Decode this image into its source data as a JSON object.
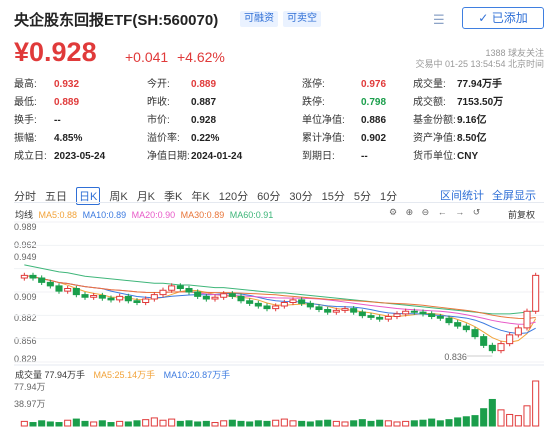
{
  "header": {
    "title": "央企股东回报ETF(SH:560070)",
    "tag_margin": "可融资",
    "tag_short": "可卖空",
    "added_label": "已添加",
    "price": "¥0.928",
    "change": "+0.041",
    "change_pct": "+4.62%",
    "followers": "1388 球友关注",
    "trade_time": "交易中 01-25 13:54:54 北京时间"
  },
  "stats": [
    [
      {
        "label": "最高:",
        "value": "0.932",
        "color": "up"
      },
      {
        "label": "今开:",
        "value": "0.889",
        "color": "up"
      },
      {
        "label": "涨停:",
        "value": "0.976",
        "color": "up"
      },
      {
        "label": "成交量:",
        "value": "77.94万手",
        "color": ""
      }
    ],
    [
      {
        "label": "最低:",
        "value": "0.889",
        "color": "up"
      },
      {
        "label": "昨收:",
        "value": "0.887",
        "color": ""
      },
      {
        "label": "跌停:",
        "value": "0.798",
        "color": "down"
      },
      {
        "label": "成交额:",
        "value": "7153.50万",
        "color": ""
      }
    ],
    [
      {
        "label": "换手:",
        "value": "--",
        "color": ""
      },
      {
        "label": "市价:",
        "value": "0.928",
        "color": ""
      },
      {
        "label": "单位净值:",
        "value": "0.886",
        "color": ""
      },
      {
        "label": "基金份额:",
        "value": "9.16亿",
        "color": ""
      }
    ],
    [
      {
        "label": "振幅:",
        "value": "4.85%",
        "color": ""
      },
      {
        "label": "溢价率:",
        "value": "0.22%",
        "color": ""
      },
      {
        "label": "累计净值:",
        "value": "0.902",
        "color": ""
      },
      {
        "label": "资产净值:",
        "value": "8.50亿",
        "color": ""
      }
    ],
    [
      {
        "label": "成立日:",
        "value": "2023-05-24",
        "color": ""
      },
      {
        "label": "净值日期:",
        "value": "2024-01-24",
        "color": ""
      },
      {
        "label": "到期日:",
        "value": "--",
        "color": ""
      },
      {
        "label": "货币单位:",
        "value": "CNY",
        "color": ""
      }
    ]
  ],
  "periods": [
    "分时",
    "五日",
    "日K",
    "周K",
    "月K",
    "季K",
    "年K",
    "120分",
    "60分",
    "30分",
    "15分",
    "5分",
    "1分"
  ],
  "active_period": "日K",
  "links": {
    "compare": "区间统计",
    "fullscreen": "全屏显示"
  },
  "ma_legend": {
    "prefix": "均线",
    "ma5": "MA5:0.88",
    "ma10": "MA10:0.89",
    "ma20": "MA20:0.90",
    "ma30": "MA30:0.89",
    "ma60": "MA60:0.91"
  },
  "adjust_label": "前复权",
  "price_axis": [
    "0.989",
    "0.962",
    "0.949",
    "0.909",
    "0.882",
    "0.856",
    "0.829"
  ],
  "low_marker": "0.836",
  "volume_legend": {
    "vol": "成交量 77.94万手",
    "ma5": "MA5:25.14万手",
    "ma10": "MA10:20.87万手"
  },
  "volume_axis": [
    "77.94万",
    "38.97万"
  ],
  "colors": {
    "up": "#e03a3a",
    "down": "#1a9e4b",
    "accent": "#2f6fd6",
    "ma5": "#f2a33a",
    "ma10": "#3d7be0",
    "ma20": "#e85ac8",
    "ma30": "#e8763a",
    "ma60": "#3fb67a"
  },
  "chart_data": {
    "type": "candlestick",
    "ylim": [
      0.829,
      0.989
    ],
    "candles_close": [
      0.928,
      0.925,
      0.92,
      0.916,
      0.91,
      0.913,
      0.906,
      0.903,
      0.905,
      0.902,
      0.9,
      0.904,
      0.899,
      0.897,
      0.901,
      0.906,
      0.911,
      0.916,
      0.913,
      0.909,
      0.904,
      0.901,
      0.903,
      0.907,
      0.904,
      0.899,
      0.896,
      0.893,
      0.89,
      0.893,
      0.897,
      0.9,
      0.896,
      0.892,
      0.889,
      0.886,
      0.888,
      0.89,
      0.886,
      0.882,
      0.88,
      0.878,
      0.881,
      0.884,
      0.887,
      0.886,
      0.884,
      0.881,
      0.879,
      0.874,
      0.87,
      0.866,
      0.858,
      0.848,
      0.842,
      0.85,
      0.86,
      0.868,
      0.887,
      0.928
    ],
    "ma60": [
      0.94,
      0.938,
      0.936,
      0.934,
      0.932,
      0.931,
      0.929,
      0.927,
      0.926,
      0.925,
      0.924,
      0.923,
      0.922,
      0.921,
      0.92,
      0.919,
      0.919,
      0.918,
      0.917,
      0.917,
      0.916,
      0.915,
      0.914,
      0.914,
      0.913,
      0.912,
      0.911,
      0.91,
      0.909,
      0.908,
      0.908,
      0.907,
      0.906,
      0.905,
      0.904,
      0.903,
      0.902,
      0.901,
      0.9,
      0.899,
      0.898,
      0.897,
      0.896,
      0.895,
      0.894,
      0.893,
      0.892,
      0.891,
      0.89,
      0.889,
      0.888,
      0.887,
      0.886,
      0.885,
      0.884,
      0.884,
      0.884,
      0.885,
      0.886,
      0.888
    ],
    "volumes": [
      8,
      6,
      9,
      7,
      6,
      10,
      12,
      8,
      7,
      9,
      6,
      8,
      7,
      9,
      11,
      14,
      10,
      12,
      8,
      9,
      7,
      8,
      6,
      9,
      10,
      8,
      7,
      9,
      8,
      10,
      12,
      9,
      8,
      7,
      9,
      10,
      8,
      7,
      9,
      11,
      8,
      10,
      9,
      7,
      8,
      9,
      10,
      12,
      9,
      11,
      14,
      16,
      18,
      30,
      46,
      28,
      20,
      18,
      35,
      78
    ]
  }
}
